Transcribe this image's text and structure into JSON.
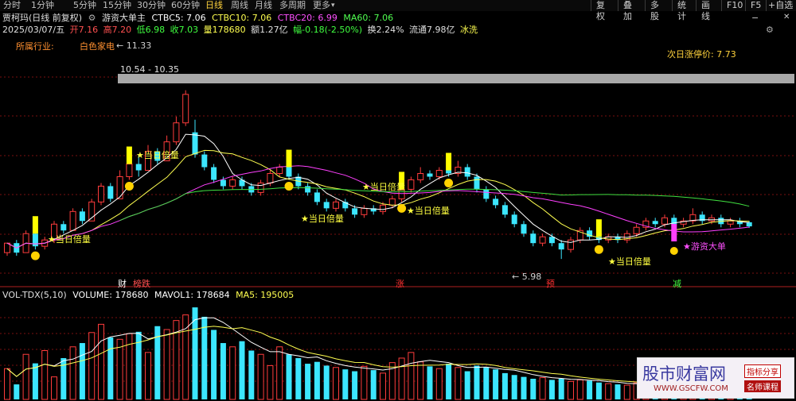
{
  "toolbar": {
    "timeframes": [
      "分时",
      "1分钟",
      "5分钟",
      "15分钟",
      "30分钟",
      "60分钟",
      "日线",
      "周线",
      "月线",
      "多周期",
      "更多"
    ],
    "active": "日线",
    "more_arrow": "▾",
    "buttons": [
      "复权",
      "叠加",
      "多股",
      "统计",
      "画线",
      "F10",
      "F5",
      "+自选"
    ],
    "icons": [
      "minus-icon",
      "close-icon"
    ],
    "minus_glyph": "−",
    "close_glyph": "✕"
  },
  "header": {
    "name": "贾柯玛(日线 前复权)",
    "indicator": "游资大单主",
    "ctbc5": "CTBC5: 7.06",
    "ctbc10": "CTBC10: 7.06",
    "ctbc20": "CTBC20: 6.99",
    "ma60": "MA60: 7.06",
    "gear_icon": "gear-icon",
    "gear_glyph": "⚙"
  },
  "quote": {
    "date": "2025/03/07/五",
    "open": "开7.16",
    "high": "高7.20",
    "low": "低6.98",
    "close": "收7.03",
    "volume": "量178680",
    "amount": "额1.27亿",
    "change": "幅-0.18(-2.50%)",
    "turnover": "换2.24%",
    "float": "流通7.98亿",
    "tag": "冰洗",
    "settings_icon": "settings-icon",
    "settings_glyph": "⚙"
  },
  "labels": {
    "industry_label": "所属行业:",
    "industry_value": "白色家电",
    "limit_up": "次日涨停价: 7.73",
    "high_price": "← 11.33",
    "range": "10.54 - 10.35",
    "low_price": "← 5.98",
    "signal": "★当日倍量",
    "big_order": "★游资大单",
    "markers": [
      {
        "text": "财",
        "x": 150,
        "color": "#ffffff"
      },
      {
        "text": "榜跌",
        "x": 170,
        "color": "#ff5050"
      },
      {
        "text": "涨",
        "x": 499,
        "color": "#ff3030"
      },
      {
        "text": "预",
        "x": 688,
        "color": "#ff3030"
      },
      {
        "text": "减",
        "x": 848,
        "color": "#40ff40"
      }
    ]
  },
  "volume_header": {
    "name": "VOL-TDX(5,10)",
    "volume": "VOLUME: 178680",
    "mavol1": "MAVOL1: 178684",
    "ma5": "MA5: 195005"
  },
  "watermark": {
    "title": "股市财富网",
    "url": "WWW.GSCFW.COM",
    "tag1": "指标分享",
    "tag2": "名师课程"
  },
  "chart_data": {
    "type": "candlestick",
    "title": "贾柯玛(日线 前复权)",
    "ylim": [
      5.2,
      12.3
    ],
    "high_label": 11.33,
    "low_label": 5.98,
    "last_close": 7.03,
    "limit_up": 7.73,
    "candles": [
      [
        6.2,
        6.5,
        6.1,
        6.5
      ],
      [
        6.5,
        6.2,
        6.1,
        6.6
      ],
      [
        6.2,
        6.8,
        6.2,
        6.9
      ],
      [
        6.8,
        6.4,
        6.3,
        6.9
      ],
      [
        6.4,
        6.6,
        6.3,
        6.7
      ],
      [
        6.6,
        7.1,
        6.5,
        7.2
      ],
      [
        7.1,
        6.9,
        6.8,
        7.2
      ],
      [
        6.9,
        7.5,
        6.9,
        7.6
      ],
      [
        7.5,
        7.2,
        7.1,
        7.6
      ],
      [
        7.2,
        7.8,
        7.2,
        7.9
      ],
      [
        7.8,
        8.3,
        7.7,
        8.4
      ],
      [
        8.3,
        7.9,
        7.8,
        8.4
      ],
      [
        7.9,
        8.6,
        7.9,
        8.8
      ],
      [
        8.6,
        9.0,
        8.5,
        9.2
      ],
      [
        9.0,
        8.8,
        8.6,
        9.3
      ],
      [
        8.8,
        9.4,
        8.8,
        9.6
      ],
      [
        9.4,
        9.1,
        9.0,
        9.5
      ],
      [
        9.1,
        9.7,
        9.1,
        9.9
      ],
      [
        9.7,
        10.3,
        9.6,
        10.5
      ],
      [
        10.3,
        11.2,
        10.2,
        11.33
      ],
      [
        10.0,
        9.3,
        9.2,
        10.4
      ],
      [
        9.3,
        8.9,
        8.8,
        9.4
      ],
      [
        8.9,
        8.5,
        8.4,
        9.0
      ],
      [
        8.5,
        8.3,
        8.2,
        8.6
      ],
      [
        8.3,
        8.5,
        8.2,
        8.6
      ],
      [
        8.5,
        8.3,
        8.2,
        8.6
      ],
      [
        8.3,
        8.1,
        8.0,
        8.4
      ],
      [
        8.1,
        8.4,
        8.0,
        8.5
      ],
      [
        8.4,
        8.7,
        8.3,
        8.8
      ],
      [
        8.7,
        8.9,
        8.6,
        9.0
      ],
      [
        8.9,
        8.6,
        8.5,
        9.0
      ],
      [
        8.6,
        8.3,
        8.2,
        8.7
      ],
      [
        8.3,
        8.1,
        8.0,
        8.4
      ],
      [
        8.1,
        7.8,
        7.7,
        8.2
      ],
      [
        7.8,
        7.6,
        7.5,
        7.9
      ],
      [
        7.6,
        7.8,
        7.5,
        7.9
      ],
      [
        7.8,
        7.6,
        7.5,
        7.9
      ],
      [
        7.6,
        7.4,
        7.3,
        7.7
      ],
      [
        7.4,
        7.6,
        7.3,
        7.7
      ],
      [
        7.6,
        7.5,
        7.4,
        7.7
      ],
      [
        7.5,
        7.7,
        7.4,
        7.8
      ],
      [
        7.7,
        7.9,
        7.6,
        8.0
      ],
      [
        7.9,
        8.2,
        7.8,
        8.3
      ],
      [
        8.2,
        8.5,
        8.1,
        8.6
      ],
      [
        8.5,
        8.7,
        8.4,
        8.9
      ],
      [
        8.7,
        8.6,
        8.5,
        8.8
      ],
      [
        8.6,
        8.8,
        8.5,
        8.9
      ],
      [
        8.8,
        8.7,
        8.6,
        9.0
      ],
      [
        8.7,
        8.9,
        8.6,
        9.1
      ],
      [
        8.9,
        8.6,
        8.5,
        9.0
      ],
      [
        8.6,
        8.2,
        8.1,
        8.7
      ],
      [
        8.2,
        7.9,
        7.8,
        8.3
      ],
      [
        7.9,
        7.7,
        7.6,
        8.0
      ],
      [
        7.7,
        7.4,
        7.3,
        7.8
      ],
      [
        7.4,
        7.1,
        7.0,
        7.5
      ],
      [
        7.1,
        6.8,
        6.7,
        7.2
      ],
      [
        6.8,
        6.5,
        6.4,
        6.9
      ],
      [
        6.5,
        6.7,
        6.4,
        6.8
      ],
      [
        6.7,
        6.5,
        6.4,
        6.8
      ],
      [
        6.5,
        6.3,
        6.0,
        6.6
      ],
      [
        6.3,
        6.6,
        6.2,
        6.7
      ],
      [
        6.6,
        6.9,
        6.5,
        7.0
      ],
      [
        6.9,
        6.7,
        6.6,
        7.0
      ],
      [
        6.7,
        6.6,
        6.5,
        6.8
      ],
      [
        6.6,
        6.7,
        6.5,
        6.8
      ],
      [
        6.7,
        6.6,
        6.5,
        6.8
      ],
      [
        6.6,
        6.8,
        6.5,
        6.9
      ],
      [
        6.8,
        7.0,
        6.7,
        7.1
      ],
      [
        7.0,
        7.2,
        6.9,
        7.3
      ],
      [
        7.2,
        7.1,
        7.0,
        7.3
      ],
      [
        7.1,
        7.3,
        7.0,
        7.4
      ],
      [
        7.3,
        7.1,
        7.0,
        7.4
      ],
      [
        7.1,
        7.2,
        7.0,
        7.3
      ],
      [
        7.2,
        7.4,
        7.1,
        7.6
      ],
      [
        7.4,
        7.2,
        7.1,
        7.5
      ],
      [
        7.2,
        7.3,
        7.1,
        7.4
      ],
      [
        7.3,
        7.1,
        7.0,
        7.4
      ],
      [
        7.1,
        7.2,
        7.0,
        7.3
      ],
      [
        7.2,
        7.1,
        7.0,
        7.3
      ],
      [
        7.16,
        7.03,
        6.98,
        7.2
      ]
    ],
    "volume": [
      82,
      40,
      120,
      96,
      130,
      60,
      110,
      140,
      150,
      178,
      200,
      165,
      160,
      175,
      180,
      125,
      195,
      186,
      210,
      225,
      245,
      220,
      185,
      150,
      140,
      155,
      130,
      120,
      90,
      140,
      120,
      110,
      95,
      100,
      90,
      85,
      80,
      75,
      88,
      78,
      70,
      98,
      110,
      125,
      100,
      88,
      82,
      95,
      85,
      75,
      90,
      85,
      80,
      70,
      65,
      60,
      55,
      58,
      52,
      55,
      48,
      52,
      50,
      45,
      42,
      40,
      38,
      44,
      50,
      46,
      42,
      40,
      38,
      45,
      42,
      40,
      38,
      35,
      36,
      32
    ],
    "ma_series": [
      "CTBC5",
      "CTBC10",
      "CTBC20",
      "MA60"
    ]
  }
}
